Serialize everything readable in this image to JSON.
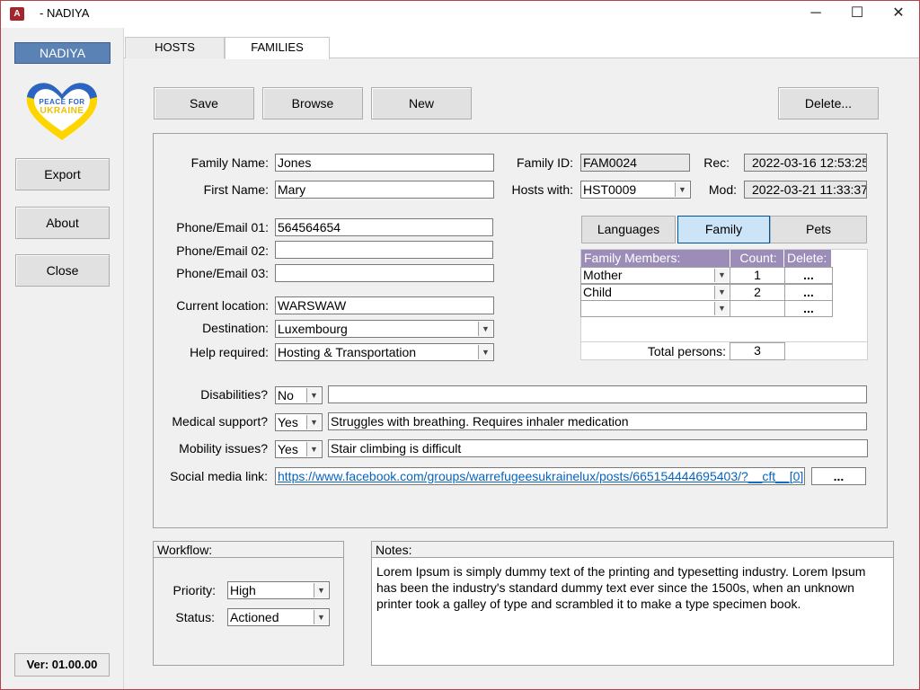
{
  "window": {
    "title": "- NADIYA",
    "app_icon": "A",
    "minimize_icon": "─",
    "maximize_icon": "☐",
    "close_icon": "✕"
  },
  "sidebar": {
    "brand": "NADIYA",
    "logo_text_line1": "PEACE FOR",
    "logo_text_line2": "UKRAINE",
    "export_label": "Export",
    "about_label": "About",
    "close_label": "Close",
    "version": "Ver: 01.00.00"
  },
  "tabs": [
    {
      "label": "HOSTS",
      "active": false
    },
    {
      "label": "FAMILIES",
      "active": true
    }
  ],
  "toolbar": {
    "save_label": "Save",
    "browse_label": "Browse",
    "new_label": "New",
    "delete_label": "Delete..."
  },
  "form": {
    "family_name_label": "Family Name:",
    "family_name": "Jones",
    "first_name_label": "First Name:",
    "first_name": "Mary",
    "phone1_label": "Phone/Email 01:",
    "phone1": "564564654",
    "phone2_label": "Phone/Email 02:",
    "phone2": "",
    "phone3_label": "Phone/Email 03:",
    "phone3": "",
    "current_location_label": "Current location:",
    "current_location": "WARSWAW",
    "destination_label": "Destination:",
    "destination": "Luxembourg",
    "help_required_label": "Help required:",
    "help_required": "Hosting & Transportation",
    "family_id_label": "Family ID:",
    "family_id": "FAM0024",
    "hosts_with_label": "Hosts with:",
    "hosts_with": "HST0009",
    "rec_label": "Rec:",
    "rec": "2022-03-16 12:53:25",
    "mod_label": "Mod:",
    "mod": "2022-03-21 11:33:37",
    "disabilities_label": "Disabilities?",
    "disabilities": "No",
    "disabilities_note": "",
    "medical_label": "Medical support?",
    "medical": "Yes",
    "medical_note": "Struggles with breathing. Requires inhaler medication",
    "mobility_label": "Mobility issues?",
    "mobility": "Yes",
    "mobility_note": "Stair climbing is difficult",
    "social_label": "Social media link:",
    "social_link": "https://www.facebook.com/groups/warrefugeesukrainelux/posts/665154444695403/?__cft__[0]",
    "social_btn": "..."
  },
  "subtabs": {
    "languages": "Languages",
    "family": "Family",
    "pets": "Pets"
  },
  "family_grid": {
    "headers": {
      "members": "Family Members:",
      "count": "Count:",
      "delete": "Delete:"
    },
    "rows": [
      {
        "member": "Mother",
        "count": "1",
        "delete": "..."
      },
      {
        "member": "Child",
        "count": "2",
        "delete": "..."
      },
      {
        "member": "",
        "count": "",
        "delete": "..."
      }
    ],
    "total_label": "Total persons:",
    "total": "3"
  },
  "workflow": {
    "header": "Workflow:",
    "priority_label": "Priority:",
    "priority": "High",
    "status_label": "Status:",
    "status": "Actioned"
  },
  "notes": {
    "header": "Notes:",
    "text": "Lorem Ipsum is simply dummy text of the printing and typesetting industry. Lorem Ipsum has been the industry's standard dummy text ever since the 1500s, when an unknown printer took a galley of type and scrambled it to make a type specimen book."
  }
}
